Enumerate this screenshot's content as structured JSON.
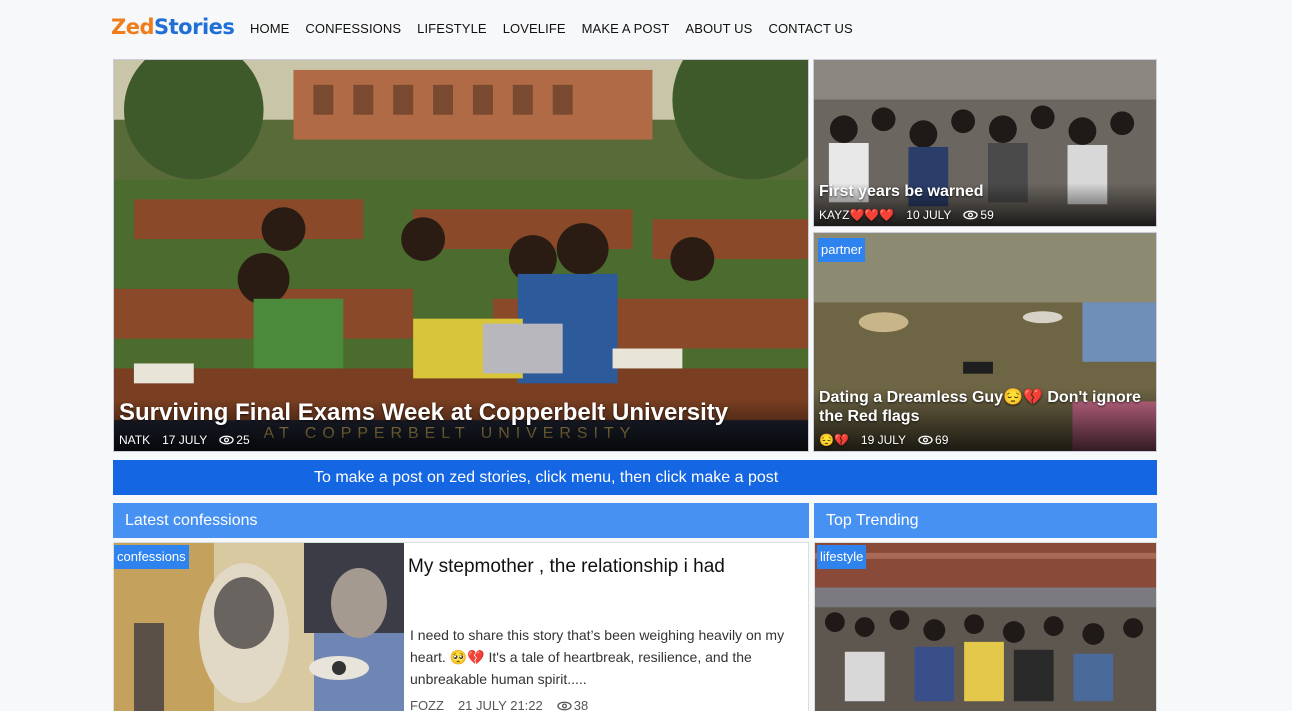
{
  "brand": {
    "part1": "Zed",
    "part2": "Stories"
  },
  "nav": [
    "HOME",
    "CONFESSIONS",
    "LIFESTYLE",
    "LOVELIFE",
    "MAKE A POST",
    "ABOUT US",
    "CONTACT US"
  ],
  "featured": {
    "main": {
      "title": "Surviving Final Exams Week at Copperbelt University",
      "author": "NATK",
      "date": "17 JULY",
      "views": "25"
    },
    "side1": {
      "title": "First years be warned",
      "author": "KAYZ❤️❤️❤️",
      "date": "10 JULY",
      "views": "59"
    },
    "side2": {
      "tag": "partner",
      "title": "Dating a Dreamless Guy😔💔 Don't ignore the Red flags",
      "author": "😔💔",
      "date": "19 JULY",
      "views": "69"
    }
  },
  "banner": "To make a post on zed stories, click menu, then click make a post",
  "latest": {
    "heading": "Latest confessions",
    "post": {
      "tag": "confessions",
      "title": "My stepmother , the relationship i had",
      "excerpt": "I need to share this story that’s been weighing heavily on my heart. 🥺💔 It's a tale of heartbreak, resilience, and the unbreakable human spirit.....",
      "author": "FOZZ",
      "datetime": "21 JULY 21:22",
      "views": "38"
    }
  },
  "trending": {
    "heading": "Top Trending",
    "tag": "lifestyle"
  },
  "colors": {
    "brand_orange": "#f07d1c",
    "brand_blue": "#1f6fd6",
    "banner": "#1466e3",
    "section": "#4791f2",
    "tag": "#2f83ee"
  },
  "icons": {
    "views": "eye-icon"
  }
}
